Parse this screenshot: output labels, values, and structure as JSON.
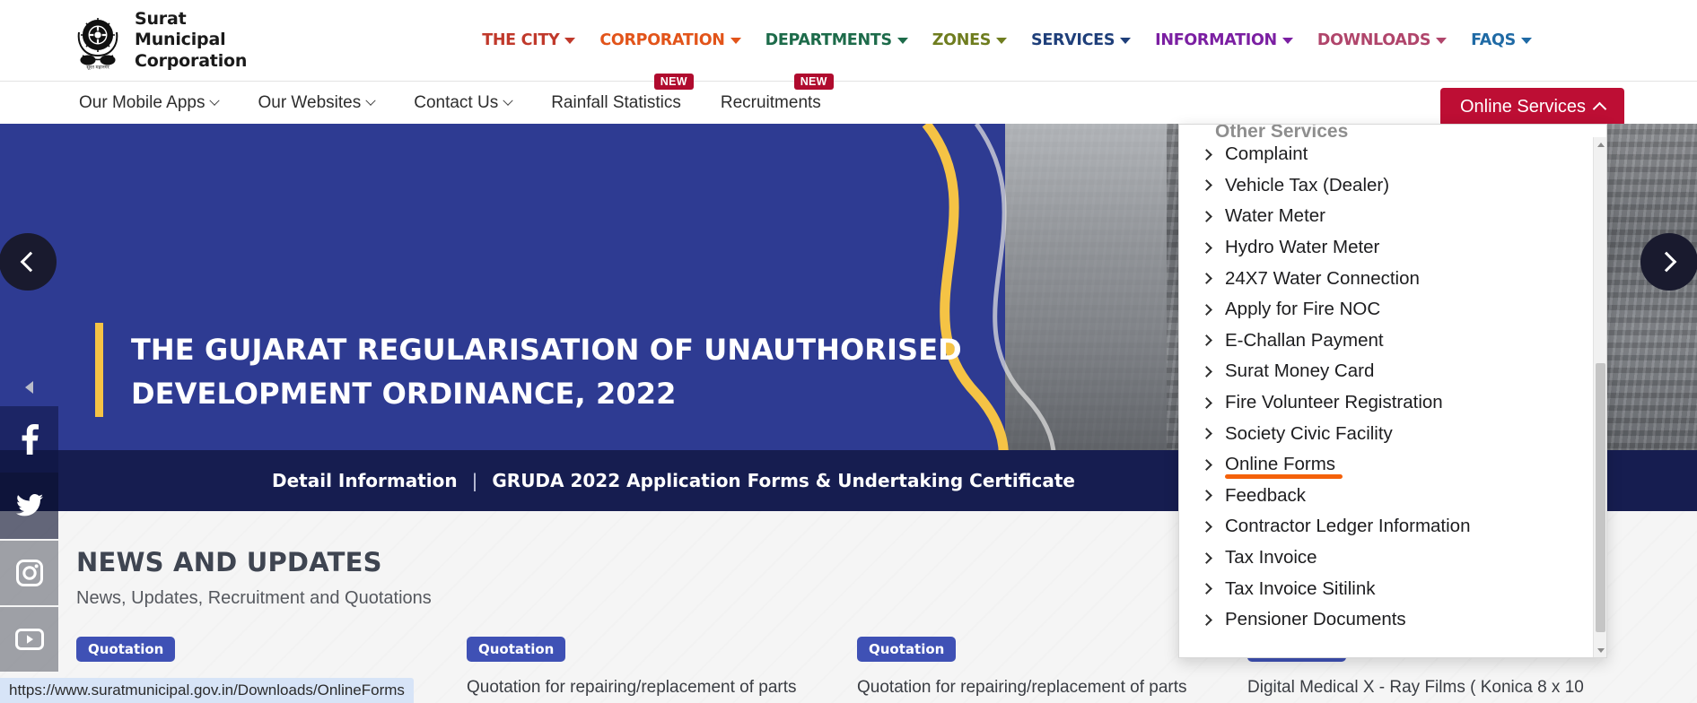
{
  "header": {
    "logo": {
      "emblem_icon": "surat-municipal-emblem",
      "line1": "Surat",
      "line2": "Municipal",
      "line3": "Corporation"
    },
    "main_nav": [
      {
        "label": "THE CITY",
        "color": "#c0392b",
        "caret": "chevron-down-icon"
      },
      {
        "label": "CORPORATION",
        "color": "#e2541a",
        "caret": "chevron-down-icon"
      },
      {
        "label": "DEPARTMENTS",
        "color": "#1d6b4a",
        "caret": "chevron-down-icon"
      },
      {
        "label": "ZONES",
        "color": "#6f7d1f",
        "caret": "chevron-down-icon"
      },
      {
        "label": "SERVICES",
        "color": "#1f3f7a",
        "caret": "chevron-down-icon"
      },
      {
        "label": "INFORMATION",
        "color": "#7b1fa2",
        "caret": "chevron-down-icon"
      },
      {
        "label": "DOWNLOADS",
        "color": "#b0456b",
        "caret": "chevron-down-icon"
      },
      {
        "label": "FAQS",
        "color": "#1f6aa5",
        "caret": "chevron-down-icon"
      }
    ]
  },
  "subnav": {
    "items": [
      {
        "label": "Our Mobile Apps",
        "has_caret": true,
        "badge": ""
      },
      {
        "label": "Our Websites",
        "has_caret": true,
        "badge": ""
      },
      {
        "label": "Contact Us",
        "has_caret": true,
        "badge": ""
      },
      {
        "label": "Rainfall Statistics",
        "has_caret": false,
        "badge": "NEW"
      },
      {
        "label": "Recruitments",
        "has_caret": false,
        "badge": "NEW"
      }
    ],
    "online_services_button": {
      "label": "Online Services",
      "caret": "chevron-up-icon",
      "color": "#bd0e34",
      "expanded": true
    }
  },
  "hero": {
    "title_line1": "THE GUJARAT REGULARISATION OF UNAUTHORISED",
    "title_line2": "DEVELOPMENT ORDINANCE, 2022",
    "accent_color": "#f5c345",
    "background_color": "#2e3b92",
    "strip": {
      "left_text": "Detail Information",
      "separator": "|",
      "right_text": "GRUDA 2022 Application Forms & Undertaking Certificate",
      "background_color": "#161d50"
    },
    "prev_arrow_icon": "chevron-left-icon",
    "next_arrow_icon": "chevron-right-icon"
  },
  "social_rail": {
    "toggle_icon": "collapse-left-icon",
    "items": [
      {
        "name": "facebook",
        "icon": "facebook-icon"
      },
      {
        "name": "twitter",
        "icon": "twitter-icon"
      },
      {
        "name": "instagram",
        "icon": "instagram-icon"
      },
      {
        "name": "youtube",
        "icon": "youtube-icon"
      }
    ]
  },
  "news": {
    "title": "NEWS AND UPDATES",
    "subtitle": "News, Updates, Recruitment and Quotations",
    "cards": [
      {
        "badge": "Quotation",
        "text": ""
      },
      {
        "badge": "Quotation",
        "text": "Quotation for repairing/replacement of parts"
      },
      {
        "badge": "Quotation",
        "text": "Quotation for repairing/replacement of parts"
      },
      {
        "badge": "Quotation",
        "text": "Digital Medical X - Ray Films ( Konica 8 x 10"
      }
    ]
  },
  "online_services_dropdown": {
    "heading": "Other Services",
    "highlighted_item": "Online Forms",
    "highlight_color": "#f4610a",
    "items": [
      {
        "label": "Complaint"
      },
      {
        "label": "Vehicle Tax (Dealer)"
      },
      {
        "label": "Water Meter"
      },
      {
        "label": "Hydro Water Meter"
      },
      {
        "label": "24X7 Water Connection"
      },
      {
        "label": "Apply for Fire NOC"
      },
      {
        "label": "E-Challan Payment"
      },
      {
        "label": "Surat Money Card"
      },
      {
        "label": "Fire Volunteer Registration"
      },
      {
        "label": "Society Civic Facility"
      },
      {
        "label": "Online Forms"
      },
      {
        "label": "Feedback"
      },
      {
        "label": "Contractor Ledger Information"
      },
      {
        "label": "Tax Invoice"
      },
      {
        "label": "Tax Invoice Sitilink"
      },
      {
        "label": "Pensioner Documents"
      }
    ],
    "scrollbar_up_icon": "scroll-up-arrow-icon",
    "scrollbar_down_icon": "scroll-down-arrow-icon"
  },
  "status_bar": {
    "url": "https://www.suratmunicipal.gov.in/Downloads/OnlineForms"
  }
}
